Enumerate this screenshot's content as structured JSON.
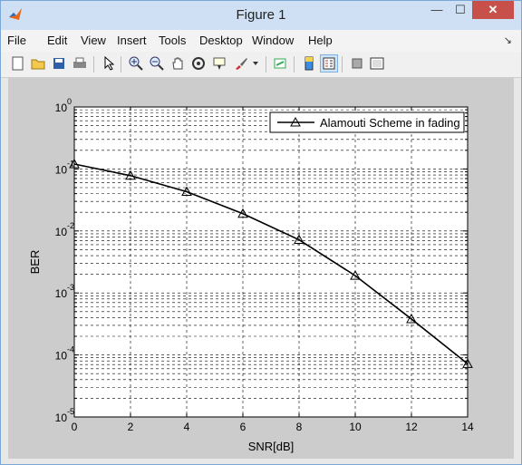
{
  "window": {
    "title": "Figure 1",
    "close_label": "✕",
    "min_label": "—",
    "max_label": "☐"
  },
  "menu": [
    "File",
    "Edit",
    "View",
    "Insert",
    "Tools",
    "Desktop",
    "Window",
    "Help"
  ],
  "toolbar_icons": [
    "new-figure-icon",
    "open-icon",
    "save-icon",
    "print-icon",
    "pointer-icon",
    "zoom-in-icon",
    "zoom-out-icon",
    "pan-icon",
    "rotate-icon",
    "data-cursor-icon",
    "brush-icon",
    "link-icon",
    "colorbar-icon",
    "legend-icon",
    "hide-tools-icon",
    "show-tools-icon"
  ],
  "chart_data": {
    "type": "line",
    "xlabel": "SNR[dB]",
    "ylabel": "BER",
    "x": [
      0,
      2,
      4,
      6,
      8,
      10,
      12,
      14
    ],
    "series": [
      {
        "name": "Alamouti Scheme in fading",
        "values": [
          0.12,
          0.078,
          0.043,
          0.019,
          0.0072,
          0.0019,
          0.00038,
          7.2e-05
        ],
        "color": "#000000",
        "marker": "triangle"
      }
    ],
    "xlim": [
      0,
      14
    ],
    "ylim": [
      1e-05,
      1
    ],
    "yscale": "log",
    "xticks": [
      "0",
      "2",
      "4",
      "6",
      "8",
      "10",
      "12",
      "14"
    ],
    "yticks": [
      {
        "base": "10",
        "exp": "0"
      },
      {
        "base": "10",
        "exp": "-1"
      },
      {
        "base": "10",
        "exp": "-2"
      },
      {
        "base": "10",
        "exp": "-3"
      },
      {
        "base": "10",
        "exp": "-4"
      },
      {
        "base": "10",
        "exp": "-5"
      }
    ],
    "grid": true,
    "legend_position": "top-right"
  }
}
